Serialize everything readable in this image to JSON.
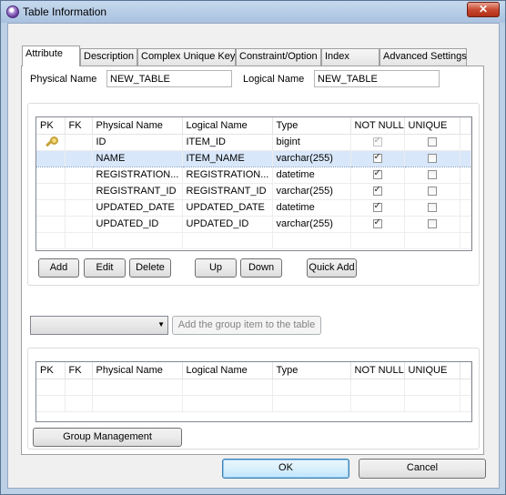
{
  "window": {
    "title": "Table Information",
    "close_glyph": "✕"
  },
  "tabs": [
    {
      "label": "Attribute",
      "active": true
    },
    {
      "label": "Description",
      "active": false
    },
    {
      "label": "Complex Unique Key",
      "active": false
    },
    {
      "label": "Constraint/Option",
      "active": false
    },
    {
      "label": "Index",
      "active": false
    },
    {
      "label": "Advanced Settings",
      "active": false
    }
  ],
  "names": {
    "physical_label": "Physical Name",
    "physical_value": "NEW_TABLE",
    "logical_label": "Logical Name",
    "logical_value": "NEW_TABLE"
  },
  "columns_table": {
    "headers": [
      "PK",
      "FK",
      "Physical Name",
      "Logical Name",
      "Type",
      "NOT NULL",
      "UNIQUE"
    ],
    "rows": [
      {
        "pk": true,
        "fk": "",
        "physical": "ID",
        "logical": "ITEM_ID",
        "type": "bigint",
        "not_null": true,
        "unique": false,
        "selected": false
      },
      {
        "pk": false,
        "fk": "",
        "physical": "NAME",
        "logical": "ITEM_NAME",
        "type": "varchar(255)",
        "not_null": true,
        "unique": false,
        "selected": true
      },
      {
        "pk": false,
        "fk": "",
        "physical": "REGISTRATION...",
        "logical": "REGISTRATION...",
        "type": "datetime",
        "not_null": true,
        "unique": false,
        "selected": false
      },
      {
        "pk": false,
        "fk": "",
        "physical": "REGISTRANT_ID",
        "logical": "REGISTRANT_ID",
        "type": "varchar(255)",
        "not_null": true,
        "unique": false,
        "selected": false
      },
      {
        "pk": false,
        "fk": "",
        "physical": "UPDATED_DATE",
        "logical": "UPDATED_DATE",
        "type": "datetime",
        "not_null": true,
        "unique": false,
        "selected": false
      },
      {
        "pk": false,
        "fk": "",
        "physical": "UPDATED_ID",
        "logical": "UPDATED_ID",
        "type": "varchar(255)",
        "not_null": true,
        "unique": false,
        "selected": false
      }
    ]
  },
  "column_buttons": {
    "add": "Add",
    "edit": "Edit",
    "delete": "Delete",
    "up": "Up",
    "down": "Down",
    "quick_add": "Quick Add"
  },
  "group": {
    "combo_value": "",
    "add_group_button": "Add the group item to the table",
    "management_button": "Group Management"
  },
  "group_table": {
    "headers": [
      "PK",
      "FK",
      "Physical Name",
      "Logical Name",
      "Type",
      "NOT NULL",
      "UNIQUE"
    ]
  },
  "footer": {
    "ok": "OK",
    "cancel": "Cancel"
  },
  "colors": {
    "selection": "#d8e7fa",
    "title_bar": "#bcd0e6",
    "close_button": "#c94a32"
  }
}
